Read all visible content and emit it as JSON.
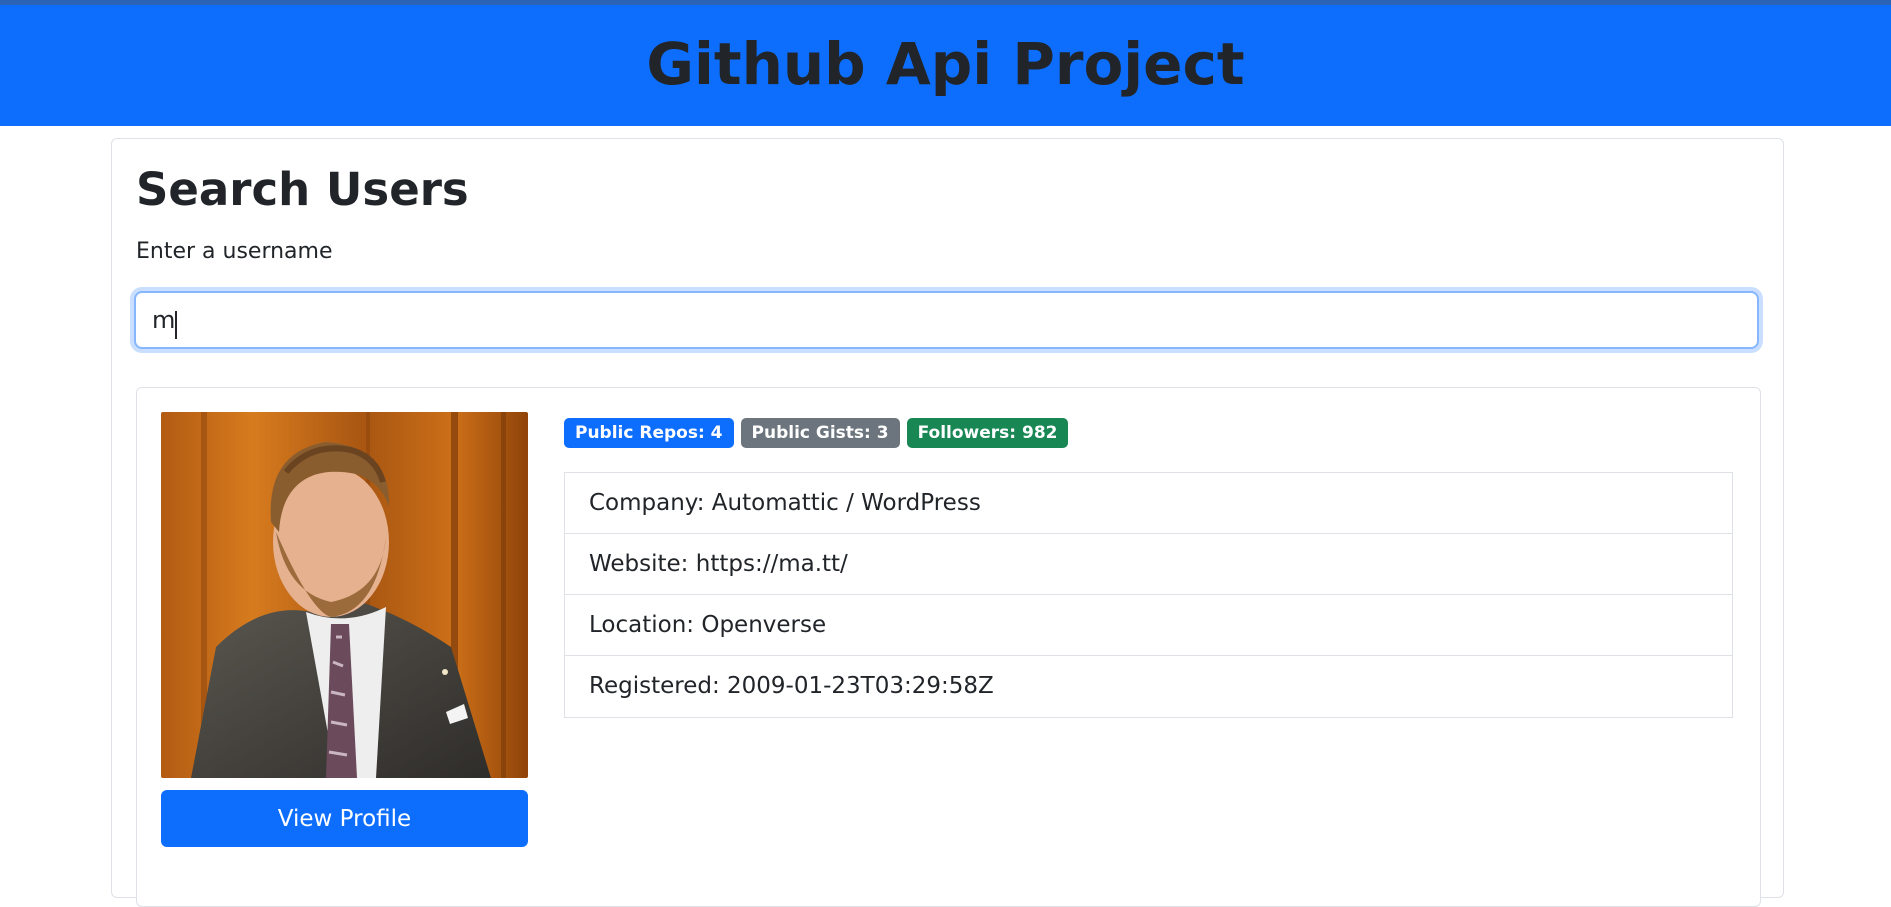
{
  "header": {
    "title": "Github Api Project"
  },
  "search": {
    "title": "Search Users",
    "label": "Enter a username",
    "value": "m"
  },
  "profile": {
    "avatar_description": "avatar-photo",
    "view_profile_label": "View Profile",
    "badges": [
      {
        "text": "Public Repos: 4",
        "color": "#0d6efd"
      },
      {
        "text": "Public Gists: 3",
        "color": "#6c757d"
      },
      {
        "text": "Followers: 982",
        "color": "#198754"
      }
    ],
    "details": [
      {
        "text": "Company: Automattic / WordPress"
      },
      {
        "text": "Website: https://ma.tt/"
      },
      {
        "text": "Location: Openverse"
      },
      {
        "text": "Registered: 2009-01-23T03:29:58Z"
      }
    ]
  },
  "colors": {
    "navbar": "#0d6efd",
    "button": "#0d6efd",
    "badge_primary": "#0d6efd",
    "badge_secondary": "#6c757d",
    "badge_success": "#198754"
  }
}
